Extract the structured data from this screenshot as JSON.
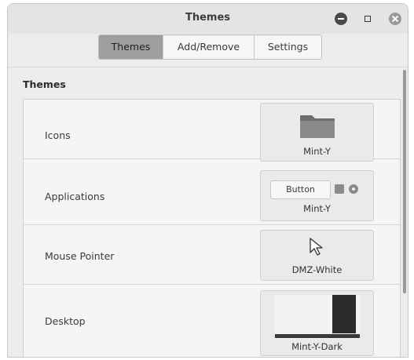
{
  "window": {
    "title": "Themes"
  },
  "tabs": [
    {
      "label": "Themes",
      "active": true
    },
    {
      "label": "Add/Remove",
      "active": false
    },
    {
      "label": "Settings",
      "active": false
    }
  ],
  "section": {
    "title": "Themes"
  },
  "rows": [
    {
      "label": "Icons",
      "value": "Mint-Y",
      "preview": "folder-icon"
    },
    {
      "label": "Applications",
      "value": "Mint-Y",
      "preview_button": "Button"
    },
    {
      "label": "Mouse Pointer",
      "value": "DMZ-White",
      "preview": "cursor-icon"
    },
    {
      "label": "Desktop",
      "value": "Mint-Y-Dark",
      "preview": "desktop-thumbnail"
    }
  ],
  "colors": {
    "active_tab": "#9e9e9e",
    "window_bg": "#ececec"
  }
}
